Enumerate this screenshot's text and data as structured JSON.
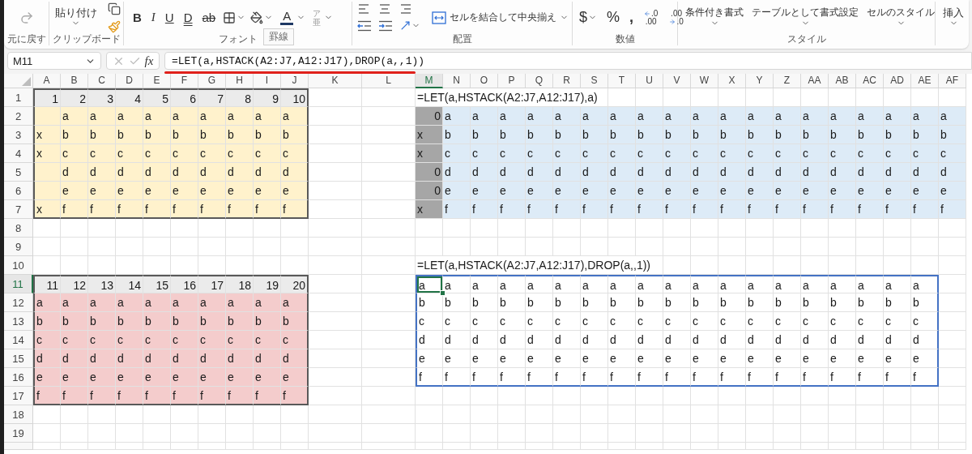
{
  "ribbon": {
    "groups": [
      {
        "kind": "undo",
        "label": "元に戻す"
      },
      {
        "kind": "clipboard",
        "label": "クリップボード",
        "paste_label": "貼り付け"
      },
      {
        "kind": "font",
        "label": "フォント",
        "format_buttons": [
          {
            "kind": "bold",
            "text": "B"
          },
          {
            "kind": "italic",
            "text": "I"
          },
          {
            "kind": "underline",
            "text": "U"
          },
          {
            "kind": "double_underline",
            "text": "D"
          },
          {
            "kind": "strike",
            "text": "ab"
          }
        ],
        "font_color_label": "A",
        "phonetic": {
          "top": "ア",
          "bottom": "亜"
        },
        "tooltip": "罫線"
      },
      {
        "kind": "alignment",
        "label": "配置",
        "merge_label": "セルを結合して中央揃え"
      },
      {
        "kind": "number",
        "label": "数値",
        "buttons": [
          {
            "text": "$",
            "dropdown": true
          },
          {
            "text": "%",
            "dropdown": false
          },
          {
            "text": ",",
            "dropdown": false
          }
        ],
        "decimal_buttons": [
          {
            "top": ".0",
            "bottom": ".00"
          },
          {
            "top": ".00",
            "bottom": ".0"
          }
        ]
      },
      {
        "kind": "styles",
        "label": "スタイル",
        "buttons": [
          "条件付き書式",
          "テーブルとして書式設定",
          "セルのスタイル"
        ]
      },
      {
        "kind": "cells",
        "buttons": [
          "挿入"
        ]
      }
    ]
  },
  "formula_bar": {
    "name_box": "M11",
    "function_label": "fx",
    "formula": "=LET(a,HSTACK(A2:J7,A12:J17),DROP(a,,1))"
  },
  "sheet": {
    "columns": [
      {
        "label": "A",
        "selected": false,
        "wide": false
      },
      {
        "label": "B",
        "selected": false,
        "wide": false
      },
      {
        "label": "C",
        "selected": false,
        "wide": false
      },
      {
        "label": "D",
        "selected": false,
        "wide": false
      },
      {
        "label": "E",
        "selected": false,
        "wide": false
      },
      {
        "label": "F",
        "selected": false,
        "wide": false
      },
      {
        "label": "G",
        "selected": false,
        "wide": false
      },
      {
        "label": "H",
        "selected": false,
        "wide": false
      },
      {
        "label": "I",
        "selected": false,
        "wide": false
      },
      {
        "label": "J",
        "selected": false,
        "wide": false
      },
      {
        "label": "K",
        "selected": false,
        "wide": true
      },
      {
        "label": "L",
        "selected": false,
        "wide": true
      },
      {
        "label": "M",
        "selected": true,
        "wide": false
      },
      {
        "label": "N",
        "selected": false,
        "wide": false
      },
      {
        "label": "O",
        "selected": false,
        "wide": false
      },
      {
        "label": "P",
        "selected": false,
        "wide": false
      },
      {
        "label": "Q",
        "selected": false,
        "wide": false
      },
      {
        "label": "R",
        "selected": false,
        "wide": false
      },
      {
        "label": "S",
        "selected": false,
        "wide": false
      },
      {
        "label": "T",
        "selected": false,
        "wide": false
      },
      {
        "label": "U",
        "selected": false,
        "wide": false
      },
      {
        "label": "V",
        "selected": false,
        "wide": false
      },
      {
        "label": "W",
        "selected": false,
        "wide": false
      },
      {
        "label": "X",
        "selected": false,
        "wide": false
      },
      {
        "label": "Y",
        "selected": false,
        "wide": false
      },
      {
        "label": "Z",
        "selected": false,
        "wide": false
      },
      {
        "label": "AA",
        "selected": false,
        "wide": false
      },
      {
        "label": "AB",
        "selected": false,
        "wide": false
      },
      {
        "label": "AC",
        "selected": false,
        "wide": false
      },
      {
        "label": "AD",
        "selected": false,
        "wide": false
      },
      {
        "label": "AE",
        "selected": false,
        "wide": false
      },
      {
        "label": "AF",
        "selected": false,
        "wide": false
      }
    ],
    "rows": [
      {
        "header": "1",
        "selected": false,
        "cells": {
          "A": "1",
          "B": "2",
          "C": "3",
          "D": "4",
          "E": "5",
          "F": "6",
          "G": "7",
          "H": "8",
          "I": "9",
          "J": "10",
          "M": "=LET(a,HSTACK(A2:J7,A12:J17),a)"
        },
        "fills": {
          "A:J": {
            "color": "#ebebeb"
          }
        }
      },
      {
        "header": "2",
        "selected": false,
        "cells": {
          "B": "a",
          "C": "a",
          "D": "a",
          "E": "a",
          "F": "a",
          "G": "a",
          "H": "a",
          "I": "a",
          "J": "a",
          "M": "0",
          "N": "a",
          "O": "a",
          "P": "a",
          "Q": "a",
          "R": "a",
          "S": "a",
          "T": "a",
          "U": "a",
          "V": "a",
          "W": "a",
          "X": "a",
          "Y": "a",
          "Z": "a",
          "AA": "a",
          "AB": "a",
          "AC": "a",
          "AD": "a",
          "AE": "a",
          "AF": "a"
        },
        "fills": {
          "A:J": {
            "color": "#fff2cc"
          },
          "M:M": {
            "color": "#a6a6a6"
          },
          "N:AF": {
            "color": "#ddebf7"
          }
        }
      },
      {
        "header": "3",
        "selected": false,
        "cells": {
          "A": "x",
          "B": "b",
          "C": "b",
          "D": "b",
          "E": "b",
          "F": "b",
          "G": "b",
          "H": "b",
          "I": "b",
          "J": "b",
          "M": "x",
          "N": "b",
          "O": "b",
          "P": "b",
          "Q": "b",
          "R": "b",
          "S": "b",
          "T": "b",
          "U": "b",
          "V": "b",
          "W": "b",
          "X": "b",
          "Y": "b",
          "Z": "b",
          "AA": "b",
          "AB": "b",
          "AC": "b",
          "AD": "b",
          "AE": "b",
          "AF": "b"
        },
        "fills": {
          "A:J": {
            "color": "#fff2cc"
          },
          "M:M": {
            "color": "#a6a6a6"
          },
          "N:AF": {
            "color": "#ddebf7"
          }
        }
      },
      {
        "header": "4",
        "selected": false,
        "cells": {
          "A": "x",
          "B": "c",
          "C": "c",
          "D": "c",
          "E": "c",
          "F": "c",
          "G": "c",
          "H": "c",
          "I": "c",
          "J": "c",
          "M": "x",
          "N": "c",
          "O": "c",
          "P": "c",
          "Q": "c",
          "R": "c",
          "S": "c",
          "T": "c",
          "U": "c",
          "V": "c",
          "W": "c",
          "X": "c",
          "Y": "c",
          "Z": "c",
          "AA": "c",
          "AB": "c",
          "AC": "c",
          "AD": "c",
          "AE": "c",
          "AF": "c"
        },
        "fills": {
          "A:J": {
            "color": "#fff2cc"
          },
          "M:M": {
            "color": "#a6a6a6"
          },
          "N:AF": {
            "color": "#ddebf7"
          }
        }
      },
      {
        "header": "5",
        "selected": false,
        "cells": {
          "B": "d",
          "C": "d",
          "D": "d",
          "E": "d",
          "F": "d",
          "G": "d",
          "H": "d",
          "I": "d",
          "J": "d",
          "M": "0",
          "N": "d",
          "O": "d",
          "P": "d",
          "Q": "d",
          "R": "d",
          "S": "d",
          "T": "d",
          "U": "d",
          "V": "d",
          "W": "d",
          "X": "d",
          "Y": "d",
          "Z": "d",
          "AA": "d",
          "AB": "d",
          "AC": "d",
          "AD": "d",
          "AE": "d",
          "AF": "d"
        },
        "fills": {
          "A:J": {
            "color": "#fff2cc"
          },
          "M:M": {
            "color": "#a6a6a6"
          },
          "N:AF": {
            "color": "#ddebf7"
          }
        }
      },
      {
        "header": "6",
        "selected": false,
        "cells": {
          "B": "e",
          "C": "e",
          "D": "e",
          "E": "e",
          "F": "e",
          "G": "e",
          "H": "e",
          "I": "e",
          "J": "e",
          "M": "0",
          "N": "e",
          "O": "e",
          "P": "e",
          "Q": "e",
          "R": "e",
          "S": "e",
          "T": "e",
          "U": "e",
          "V": "e",
          "W": "e",
          "X": "e",
          "Y": "e",
          "Z": "e",
          "AA": "e",
          "AB": "e",
          "AC": "e",
          "AD": "e",
          "AE": "e",
          "AF": "e"
        },
        "fills": {
          "A:J": {
            "color": "#fff2cc"
          },
          "M:M": {
            "color": "#a6a6a6"
          },
          "N:AF": {
            "color": "#ddebf7"
          }
        }
      },
      {
        "header": "7",
        "selected": false,
        "cells": {
          "A": "x",
          "B": "f",
          "C": "f",
          "D": "f",
          "E": "f",
          "F": "f",
          "G": "f",
          "H": "f",
          "I": "f",
          "J": "f",
          "M": "x",
          "N": "f",
          "O": "f",
          "P": "f",
          "Q": "f",
          "R": "f",
          "S": "f",
          "T": "f",
          "U": "f",
          "V": "f",
          "W": "f",
          "X": "f",
          "Y": "f",
          "Z": "f",
          "AA": "f",
          "AB": "f",
          "AC": "f",
          "AD": "f",
          "AE": "f",
          "AF": "f"
        },
        "fills": {
          "A:J": {
            "color": "#fff2cc"
          },
          "M:M": {
            "color": "#a6a6a6"
          },
          "N:AF": {
            "color": "#ddebf7"
          }
        }
      },
      {
        "header": "8",
        "selected": false
      },
      {
        "header": "9",
        "selected": false
      },
      {
        "header": "10",
        "selected": false,
        "cells": {
          "M": "=LET(a,HSTACK(A2:J7,A12:J17),DROP(a,,1))"
        }
      },
      {
        "header": "11",
        "selected": true,
        "cells": {
          "A": "11",
          "B": "12",
          "C": "13",
          "D": "14",
          "E": "15",
          "F": "16",
          "G": "17",
          "H": "18",
          "I": "19",
          "J": "20",
          "M": "a",
          "N": "a",
          "O": "a",
          "P": "a",
          "Q": "a",
          "R": "a",
          "S": "a",
          "T": "a",
          "U": "a",
          "V": "a",
          "W": "a",
          "X": "a",
          "Y": "a",
          "Z": "a",
          "AA": "a",
          "AB": "a",
          "AC": "a",
          "AD": "a",
          "AE": "a"
        },
        "fills": {
          "A:J": {
            "color": "#ebebeb"
          }
        }
      },
      {
        "header": "12",
        "selected": false,
        "cells": {
          "A": "a",
          "B": "a",
          "C": "a",
          "D": "a",
          "E": "a",
          "F": "a",
          "G": "a",
          "H": "a",
          "I": "a",
          "J": "a",
          "M": "b",
          "N": "b",
          "O": "b",
          "P": "b",
          "Q": "b",
          "R": "b",
          "S": "b",
          "T": "b",
          "U": "b",
          "V": "b",
          "W": "b",
          "X": "b",
          "Y": "b",
          "Z": "b",
          "AA": "b",
          "AB": "b",
          "AC": "b",
          "AD": "b",
          "AE": "b"
        },
        "fills": {
          "A:J": {
            "color": "#f4cccc"
          }
        }
      },
      {
        "header": "13",
        "selected": false,
        "cells": {
          "A": "b",
          "B": "b",
          "C": "b",
          "D": "b",
          "E": "b",
          "F": "b",
          "G": "b",
          "H": "b",
          "I": "b",
          "J": "b",
          "M": "c",
          "N": "c",
          "O": "c",
          "P": "c",
          "Q": "c",
          "R": "c",
          "S": "c",
          "T": "c",
          "U": "c",
          "V": "c",
          "W": "c",
          "X": "c",
          "Y": "c",
          "Z": "c",
          "AA": "c",
          "AB": "c",
          "AC": "c",
          "AD": "c",
          "AE": "c"
        },
        "fills": {
          "A:J": {
            "color": "#f4cccc"
          }
        }
      },
      {
        "header": "14",
        "selected": false,
        "cells": {
          "A": "c",
          "B": "c",
          "C": "c",
          "D": "c",
          "E": "c",
          "F": "c",
          "G": "c",
          "H": "c",
          "I": "c",
          "J": "c",
          "M": "d",
          "N": "d",
          "O": "d",
          "P": "d",
          "Q": "d",
          "R": "d",
          "S": "d",
          "T": "d",
          "U": "d",
          "V": "d",
          "W": "d",
          "X": "d",
          "Y": "d",
          "Z": "d",
          "AA": "d",
          "AB": "d",
          "AC": "d",
          "AD": "d",
          "AE": "d"
        },
        "fills": {
          "A:J": {
            "color": "#f4cccc"
          }
        }
      },
      {
        "header": "15",
        "selected": false,
        "cells": {
          "A": "d",
          "B": "d",
          "C": "d",
          "D": "d",
          "E": "d",
          "F": "d",
          "G": "d",
          "H": "d",
          "I": "d",
          "J": "d",
          "M": "e",
          "N": "e",
          "O": "e",
          "P": "e",
          "Q": "e",
          "R": "e",
          "S": "e",
          "T": "e",
          "U": "e",
          "V": "e",
          "W": "e",
          "X": "e",
          "Y": "e",
          "Z": "e",
          "AA": "e",
          "AB": "e",
          "AC": "e",
          "AD": "e",
          "AE": "e"
        },
        "fills": {
          "A:J": {
            "color": "#f4cccc"
          }
        }
      },
      {
        "header": "16",
        "selected": false,
        "cells": {
          "A": "e",
          "B": "e",
          "C": "e",
          "D": "e",
          "E": "e",
          "F": "e",
          "G": "e",
          "H": "e",
          "I": "e",
          "J": "e",
          "M": "f",
          "N": "f",
          "O": "f",
          "P": "f",
          "Q": "f",
          "R": "f",
          "S": "f",
          "T": "f",
          "U": "f",
          "V": "f",
          "W": "f",
          "X": "f",
          "Y": "f",
          "Z": "f",
          "AA": "f",
          "AB": "f",
          "AC": "f",
          "AD": "f",
          "AE": "f"
        },
        "fills": {
          "A:J": {
            "color": "#f4cccc"
          }
        }
      },
      {
        "header": "17",
        "selected": false,
        "cells": {
          "A": "f",
          "B": "f",
          "C": "f",
          "D": "f",
          "E": "f",
          "F": "f",
          "G": "f",
          "H": "f",
          "I": "f",
          "J": "f"
        },
        "fills": {
          "A:J": {
            "color": "#f4cccc"
          }
        }
      },
      {
        "header": "18",
        "selected": false
      },
      {
        "header": "19",
        "selected": false
      }
    ],
    "outlines": {
      "A1:J7": {
        "color": "#595959"
      },
      "A11:J17": {
        "color": "#595959"
      },
      "M11:AE16": {
        "color": "#4472c4"
      }
    }
  }
}
